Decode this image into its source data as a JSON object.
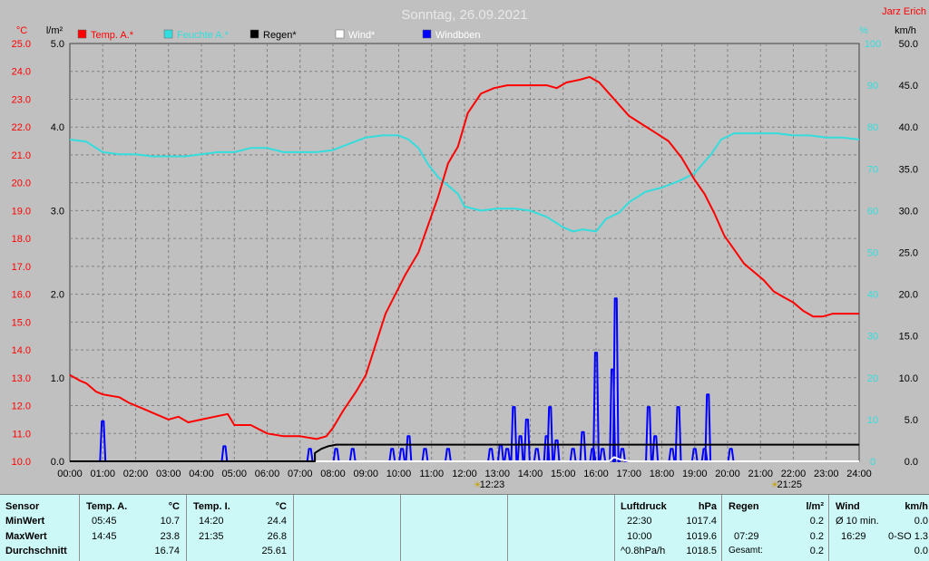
{
  "header": {
    "title": "Sonntag, 26.09.2021",
    "author": "Jarz Erich"
  },
  "colors": {
    "background": "#c0c0c0",
    "temp": "#ff0000",
    "humidity": "#33dddd",
    "rain": "#000000",
    "wind": "#ffffff",
    "gusts": "#0000ff",
    "axis_left": "#ff0000",
    "axis_right": "#33dddd",
    "table_bg": "#ccf8f8"
  },
  "legend": [
    {
      "label": "Temp. A.*",
      "color": "#ff0000",
      "text_color": "#ff0000"
    },
    {
      "label": "Feuchte A.*",
      "color": "#33dddd",
      "text_color": "#33dddd"
    },
    {
      "label": "Regen*",
      "color": "#000000",
      "text_color": "#000000"
    },
    {
      "label": "Wind*",
      "color": "#ffffff",
      "text_color": "#ffffff"
    },
    {
      "label": "Windböen",
      "color": "#0000ff",
      "text_color": "#ffffff"
    }
  ],
  "chart_data": {
    "type": "line",
    "units": {
      "temp": "°C",
      "rain": "l/m²",
      "humidity": "%",
      "wind": "km/h"
    },
    "axes": {
      "temp": {
        "range": [
          10.0,
          25.0
        ],
        "ticks": [
          "10.0",
          "11.0",
          "12.0",
          "13.0",
          "14.0",
          "15.0",
          "16.0",
          "17.0",
          "18.0",
          "19.0",
          "20.0",
          "21.0",
          "22.0",
          "23.0",
          "24.0",
          "25.0"
        ]
      },
      "rain": {
        "range": [
          0.0,
          5.0
        ],
        "ticks": [
          "0.0",
          "1.0",
          "2.0",
          "3.0",
          "4.0",
          "5.0"
        ]
      },
      "humidity": {
        "range": [
          0,
          100
        ],
        "ticks": [
          "0",
          "10",
          "20",
          "30",
          "40",
          "50",
          "60",
          "70",
          "80",
          "90",
          "100"
        ]
      },
      "wind": {
        "range": [
          0.0,
          50.0
        ],
        "ticks": [
          "0.0",
          "5.0",
          "10.0",
          "15.0",
          "20.0",
          "25.0",
          "30.0",
          "35.0",
          "40.0",
          "45.0",
          "50.0"
        ]
      },
      "x": {
        "range": [
          0,
          24
        ],
        "ticks": [
          "00:00",
          "01:00",
          "02:00",
          "03:00",
          "04:00",
          "05:00",
          "06:00",
          "07:00",
          "08:00",
          "09:00",
          "10:00",
          "11:00",
          "12:00",
          "13:00",
          "14:00",
          "15:00",
          "16:00",
          "17:00",
          "18:00",
          "19:00",
          "20:00",
          "21:00",
          "22:00",
          "23:00",
          "24:00"
        ]
      }
    },
    "grid": true,
    "sun_markers": [
      {
        "time": 12.38,
        "label": "12:23"
      },
      {
        "time": 21.42,
        "label": "21:25"
      }
    ],
    "temp_series": [
      [
        0,
        13.1
      ],
      [
        0.3,
        12.9
      ],
      [
        0.5,
        12.8
      ],
      [
        0.8,
        12.5
      ],
      [
        1.0,
        12.4
      ],
      [
        1.5,
        12.3
      ],
      [
        1.8,
        12.1
      ],
      [
        2.2,
        11.9
      ],
      [
        2.6,
        11.7
      ],
      [
        3.0,
        11.5
      ],
      [
        3.3,
        11.6
      ],
      [
        3.6,
        11.4
      ],
      [
        4.0,
        11.5
      ],
      [
        4.4,
        11.6
      ],
      [
        4.8,
        11.7
      ],
      [
        5.0,
        11.3
      ],
      [
        5.5,
        11.3
      ],
      [
        6.0,
        11.0
      ],
      [
        6.5,
        10.9
      ],
      [
        7.0,
        10.9
      ],
      [
        7.5,
        10.8
      ],
      [
        7.8,
        10.9
      ],
      [
        8.0,
        11.2
      ],
      [
        8.3,
        11.8
      ],
      [
        8.7,
        12.5
      ],
      [
        9.0,
        13.1
      ],
      [
        9.3,
        14.2
      ],
      [
        9.6,
        15.3
      ],
      [
        9.9,
        16.0
      ],
      [
        10.2,
        16.7
      ],
      [
        10.6,
        17.5
      ],
      [
        10.9,
        18.5
      ],
      [
        11.2,
        19.5
      ],
      [
        11.5,
        20.7
      ],
      [
        11.8,
        21.3
      ],
      [
        12.1,
        22.5
      ],
      [
        12.5,
        23.2
      ],
      [
        12.9,
        23.4
      ],
      [
        13.3,
        23.5
      ],
      [
        13.7,
        23.5
      ],
      [
        14.1,
        23.5
      ],
      [
        14.5,
        23.5
      ],
      [
        14.8,
        23.4
      ],
      [
        15.1,
        23.6
      ],
      [
        15.5,
        23.7
      ],
      [
        15.8,
        23.8
      ],
      [
        16.1,
        23.6
      ],
      [
        16.4,
        23.2
      ],
      [
        16.7,
        22.8
      ],
      [
        17.0,
        22.4
      ],
      [
        17.4,
        22.1
      ],
      [
        17.8,
        21.8
      ],
      [
        18.2,
        21.5
      ],
      [
        18.6,
        20.9
      ],
      [
        19.0,
        20.1
      ],
      [
        19.3,
        19.6
      ],
      [
        19.6,
        18.9
      ],
      [
        19.9,
        18.1
      ],
      [
        20.2,
        17.6
      ],
      [
        20.5,
        17.1
      ],
      [
        20.8,
        16.8
      ],
      [
        21.1,
        16.5
      ],
      [
        21.4,
        16.1
      ],
      [
        21.7,
        15.9
      ],
      [
        22.0,
        15.7
      ],
      [
        22.3,
        15.4
      ],
      [
        22.6,
        15.2
      ],
      [
        22.9,
        15.2
      ],
      [
        23.2,
        15.3
      ],
      [
        23.5,
        15.3
      ],
      [
        23.8,
        15.3
      ],
      [
        24.0,
        15.3
      ]
    ],
    "humidity_series": [
      [
        0,
        77
      ],
      [
        0.5,
        76.5
      ],
      [
        1.0,
        74
      ],
      [
        1.5,
        73.5
      ],
      [
        2.0,
        73.5
      ],
      [
        2.5,
        73
      ],
      [
        3.0,
        73
      ],
      [
        3.5,
        73
      ],
      [
        4.0,
        73.5
      ],
      [
        4.5,
        74
      ],
      [
        5.0,
        74
      ],
      [
        5.5,
        75
      ],
      [
        6.0,
        75
      ],
      [
        6.5,
        74
      ],
      [
        7.0,
        74
      ],
      [
        7.5,
        74
      ],
      [
        8.0,
        74.5
      ],
      [
        8.5,
        76
      ],
      [
        9.0,
        77.5
      ],
      [
        9.5,
        78
      ],
      [
        10.0,
        78
      ],
      [
        10.3,
        77
      ],
      [
        10.6,
        75
      ],
      [
        10.9,
        71
      ],
      [
        11.2,
        68
      ],
      [
        11.5,
        66
      ],
      [
        11.8,
        64
      ],
      [
        12.0,
        61
      ],
      [
        12.5,
        60
      ],
      [
        13.0,
        60.5
      ],
      [
        13.5,
        60.5
      ],
      [
        14.0,
        60
      ],
      [
        14.5,
        58.5
      ],
      [
        15.0,
        56
      ],
      [
        15.3,
        55
      ],
      [
        15.6,
        55.5
      ],
      [
        16.0,
        55
      ],
      [
        16.3,
        58
      ],
      [
        16.7,
        59.5
      ],
      [
        17.0,
        62
      ],
      [
        17.5,
        64.5
      ],
      [
        18.0,
        65.5
      ],
      [
        18.5,
        67
      ],
      [
        19.0,
        69
      ],
      [
        19.5,
        73.5
      ],
      [
        19.8,
        77
      ],
      [
        20.2,
        78.5
      ],
      [
        20.6,
        78.5
      ],
      [
        21.0,
        78.5
      ],
      [
        21.5,
        78.5
      ],
      [
        22.0,
        78
      ],
      [
        22.5,
        78
      ],
      [
        23.0,
        77.5
      ],
      [
        23.5,
        77.5
      ],
      [
        24.0,
        77
      ]
    ],
    "rain_series": [
      [
        0,
        0
      ],
      [
        7.45,
        0
      ],
      [
        7.45,
        0.1
      ],
      [
        7.65,
        0.15
      ],
      [
        7.85,
        0.18
      ],
      [
        8.1,
        0.2
      ],
      [
        24.0,
        0.2
      ]
    ],
    "wind_series": [
      [
        0,
        0
      ],
      [
        16.4,
        0
      ],
      [
        16.55,
        0.5
      ],
      [
        16.75,
        0.2
      ],
      [
        17.0,
        0
      ],
      [
        24,
        0
      ]
    ],
    "gust_peaks": [
      [
        1.0,
        4.8
      ],
      [
        4.7,
        1.8
      ],
      [
        7.3,
        1.5
      ],
      [
        8.1,
        1.5
      ],
      [
        8.6,
        1.5
      ],
      [
        9.8,
        1.5
      ],
      [
        10.1,
        1.5
      ],
      [
        10.3,
        3.0
      ],
      [
        10.8,
        1.5
      ],
      [
        11.5,
        1.5
      ],
      [
        12.8,
        1.5
      ],
      [
        13.1,
        2.0
      ],
      [
        13.3,
        1.5
      ],
      [
        13.5,
        6.5
      ],
      [
        13.7,
        3.0
      ],
      [
        13.9,
        5.0
      ],
      [
        14.2,
        1.5
      ],
      [
        14.5,
        3.0
      ],
      [
        14.6,
        6.5
      ],
      [
        14.8,
        2.5
      ],
      [
        15.3,
        1.5
      ],
      [
        15.6,
        3.5
      ],
      [
        15.9,
        1.5
      ],
      [
        16.0,
        13.0
      ],
      [
        16.2,
        1.5
      ],
      [
        16.5,
        11.0
      ],
      [
        16.6,
        19.5
      ],
      [
        16.8,
        1.5
      ],
      [
        17.6,
        6.5
      ],
      [
        17.8,
        3.0
      ],
      [
        18.3,
        1.5
      ],
      [
        18.5,
        6.5
      ],
      [
        19.0,
        1.5
      ],
      [
        19.3,
        1.5
      ],
      [
        19.4,
        8.0
      ],
      [
        20.1,
        1.5
      ]
    ]
  },
  "table": {
    "sensor": {
      "header": "Sensor",
      "rows": [
        "MinWert",
        "MaxWert",
        "Durchschnitt"
      ]
    },
    "temp_a": {
      "header": "Temp. A.",
      "unit": "°C",
      "min_time": "05:45",
      "min_value": "10.7",
      "max_time": "14:45",
      "max_value": "23.8",
      "avg_value": "16.74"
    },
    "temp_i": {
      "header": "Temp. I.",
      "unit": "°C",
      "min_time": "14:20",
      "min_value": "24.4",
      "max_time": "21:35",
      "max_value": "26.8",
      "avg_value": "25.61"
    },
    "pressure": {
      "header": "Luftdruck",
      "unit": "hPa",
      "min_time": "22:30",
      "min_value": "1017.4",
      "max_time": "10:00",
      "max_value": "1019.6",
      "avg_label": "^0.8hPa/h",
      "avg_value": "1018.5"
    },
    "rain": {
      "header": "Regen",
      "unit": "l/m²",
      "r1_value": "0.2",
      "r2_time": "07:29",
      "r2_value": "0.2",
      "r3_label": "Gesamt:",
      "r3_value": "0.2"
    },
    "wind": {
      "header": "Wind",
      "unit": "km/h",
      "r1_label": "Ø 10 min.",
      "r1_value": "0.0",
      "r2_time": "16:29",
      "r2_label": "0-SO 1.3",
      "r3_value": "0.0"
    }
  }
}
